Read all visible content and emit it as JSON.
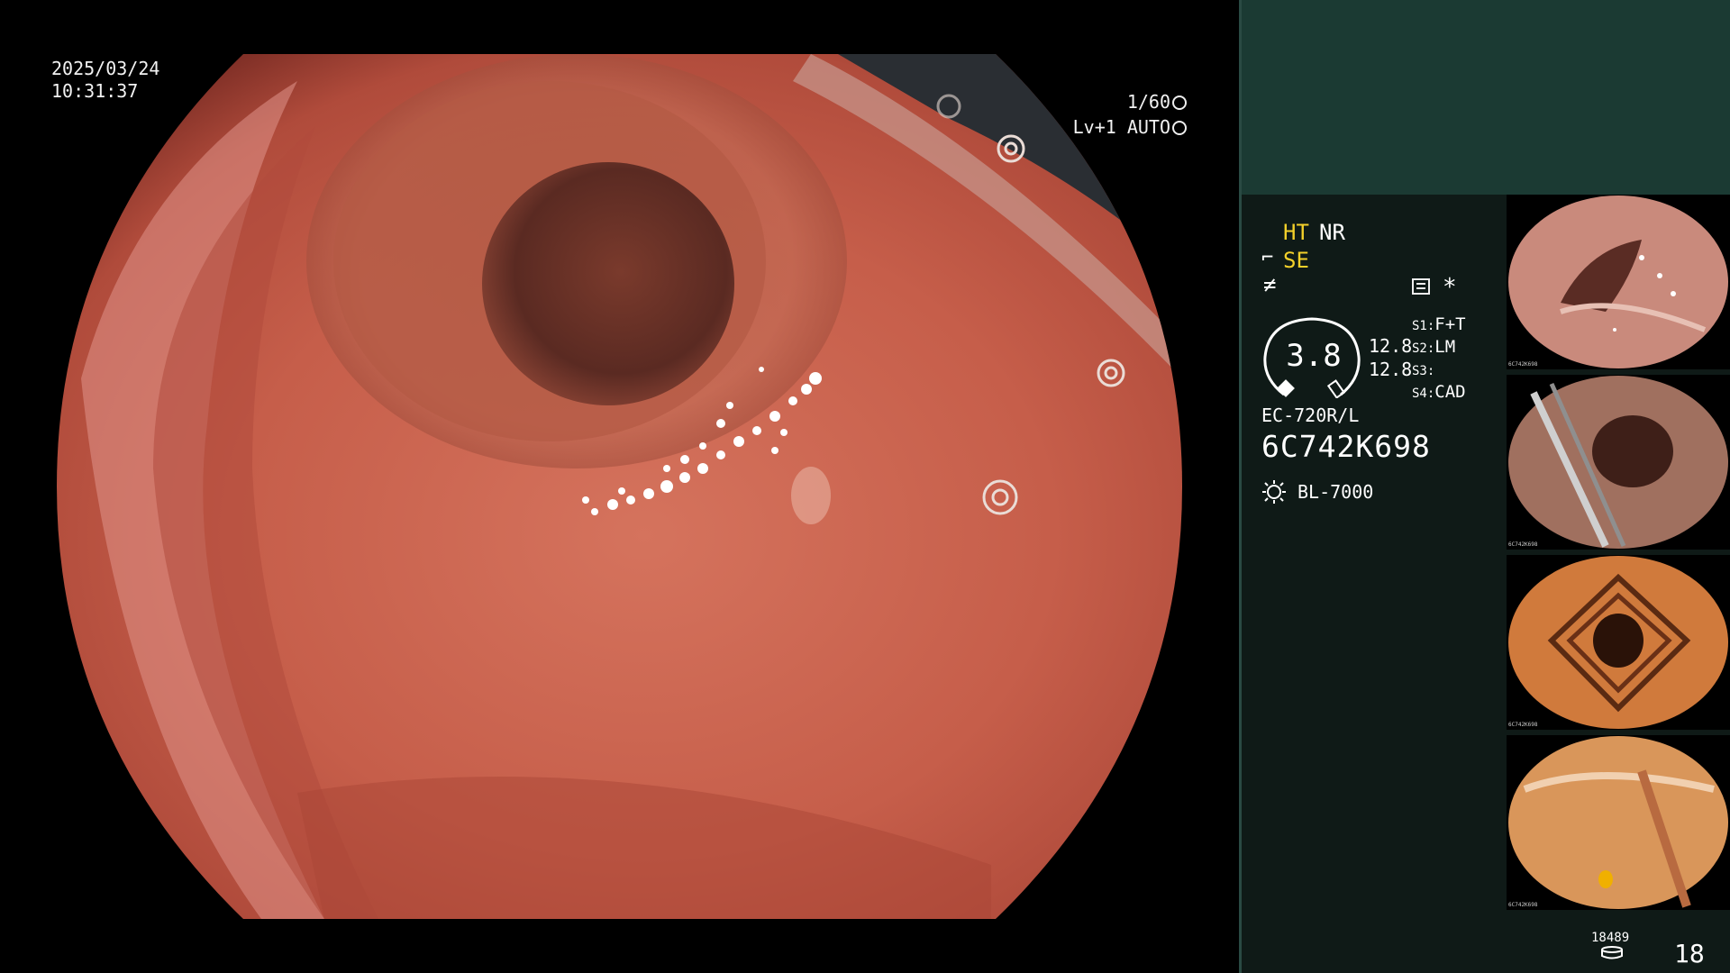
{
  "video": {
    "date": "2025/03/24",
    "time": "10:31:37",
    "shutter": "1/60",
    "level": "Lv+1 AUTO"
  },
  "panel": {
    "ht": "HT",
    "nr": "NR",
    "se": "SE",
    "zoom": "3.8",
    "value_a": "12.8",
    "value_b": "12.8",
    "switches": [
      {
        "key": "S1:",
        "value": "F+T"
      },
      {
        "key": "S2:",
        "value": "LM"
      },
      {
        "key": "S3:",
        "value": ""
      },
      {
        "key": "S4:",
        "value": "CAD"
      }
    ],
    "scope_model": "EC-720R/L",
    "serial": "6C742K698",
    "lamp": "BL-7000"
  },
  "thumbnails": [
    {
      "id": "6C742K698"
    },
    {
      "id": "6C742K698"
    },
    {
      "id": "6C742K698"
    },
    {
      "id": "6C742K698"
    }
  ],
  "footer": {
    "count_small": "18489",
    "count_big": "18"
  },
  "colors": {
    "panel_bg": "#0f1a17",
    "panel_top": "#1b3a33",
    "highlight_yellow": "#f3d02a",
    "mucosa": "#c8604e"
  },
  "icons": [
    "shutter-icon",
    "auto-icon",
    "menu-icon",
    "asterisk-icon",
    "zoom-gauge-icon",
    "lamp-icon",
    "disk-icon"
  ]
}
